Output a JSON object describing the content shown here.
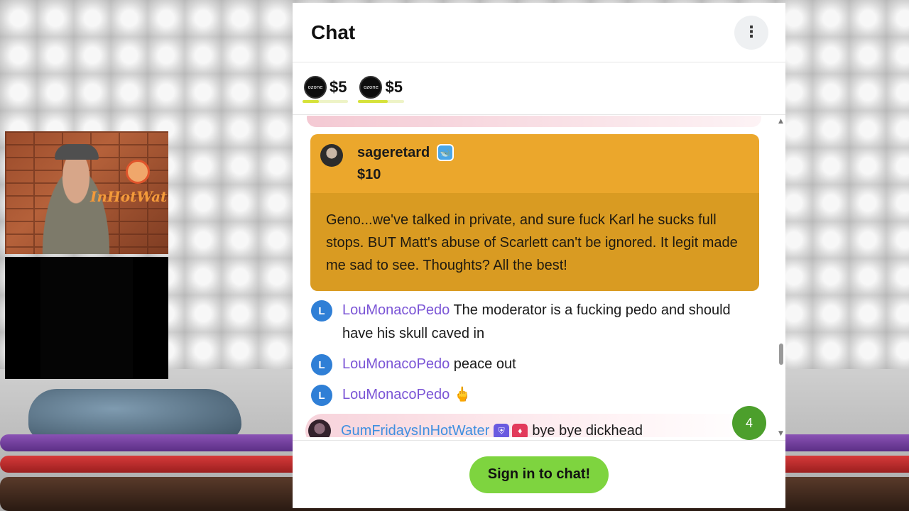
{
  "chat": {
    "title": "Chat",
    "menu_icon": "more-vertical-icon",
    "tips": [
      {
        "amount": "$5",
        "progress": 0.35
      },
      {
        "amount": "$5",
        "progress": 0.65
      }
    ],
    "donation": {
      "username": "sagere­tard",
      "amount": "$10",
      "badge_icon": "whale-icon",
      "message": "Geno...we've talked in private, and sure fuck Karl he sucks full stops. BUT Matt's abuse of Scarlett can't be ignored. It legit made me sad to see. Thoughts? All the best!"
    },
    "messages": [
      {
        "avatar_letter": "L",
        "username": "LouMonacoPedo",
        "text": "The moderator is a fucking pedo and should have his skull caved in"
      },
      {
        "avatar_letter": "L",
        "username": "LouMonacoPedo",
        "text": "peace out"
      },
      {
        "avatar_letter": "L",
        "username": "LouMonacoPedo",
        "text": "🖕"
      },
      {
        "username": "GumFridaysInHotWater",
        "text": "bye bye dickhead"
      }
    ],
    "new_messages_count": "4",
    "sign_in_label": "Sign in to chat!"
  },
  "stream": {
    "overlay_logo_text": "InHotWat"
  }
}
